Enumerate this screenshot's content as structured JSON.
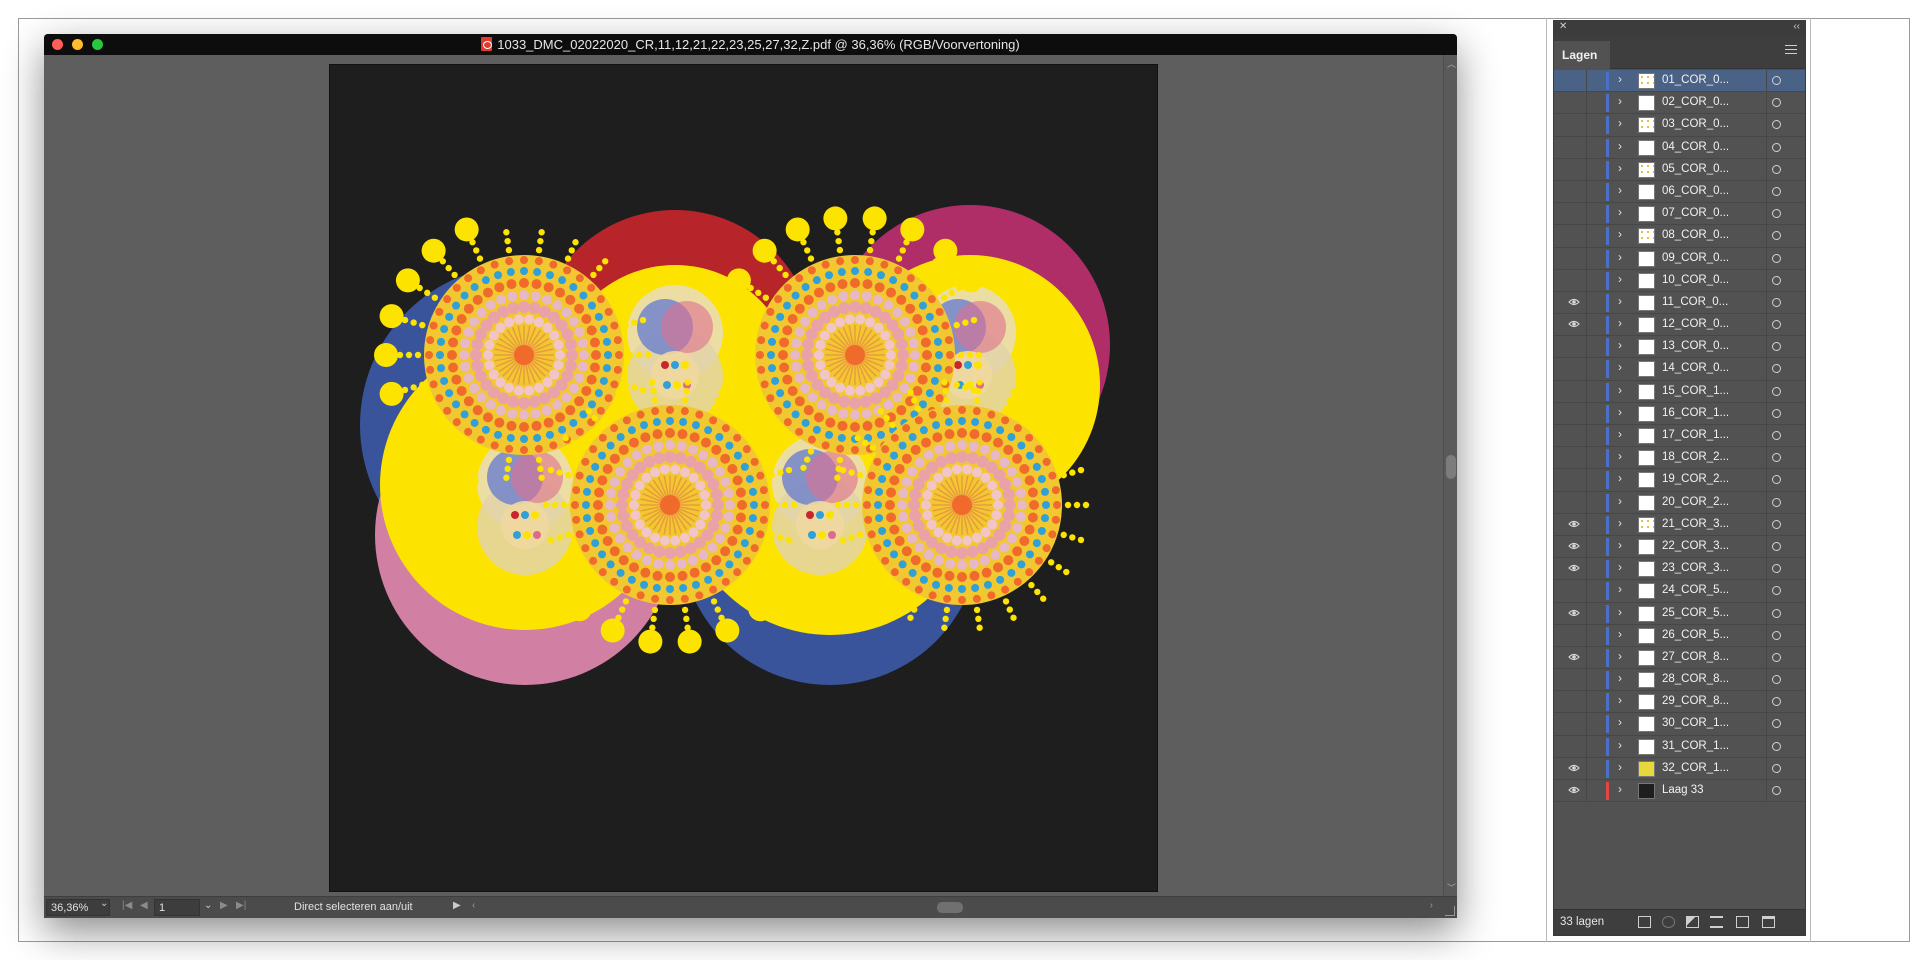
{
  "window": {
    "title": "1033_DMC_02022020_CR,11,12,21,22,23,25,27,32,Z.pdf @ 36,36% (RGB/Voorvertoning)",
    "zoom": "36,36%",
    "page": "1",
    "status_text": "Direct selecteren aan/uit"
  },
  "panel": {
    "tab_label": "Lagen",
    "layer_count": "33 lagen",
    "layers": [
      {
        "name": "01_COR_0...",
        "visible": false,
        "color": "#4c6fc8",
        "thumb": "dotted",
        "selected": true
      },
      {
        "name": "02_COR_0...",
        "visible": false,
        "color": "#4c6fc8",
        "thumb": "white"
      },
      {
        "name": "03_COR_0...",
        "visible": false,
        "color": "#4c6fc8",
        "thumb": "dotted"
      },
      {
        "name": "04_COR_0...",
        "visible": false,
        "color": "#4c6fc8",
        "thumb": "white"
      },
      {
        "name": "05_COR_0...",
        "visible": false,
        "color": "#4c6fc8",
        "thumb": "dotted"
      },
      {
        "name": "06_COR_0...",
        "visible": false,
        "color": "#4c6fc8",
        "thumb": "white"
      },
      {
        "name": "07_COR_0...",
        "visible": false,
        "color": "#4c6fc8",
        "thumb": "white"
      },
      {
        "name": "08_COR_0...",
        "visible": false,
        "color": "#4c6fc8",
        "thumb": "dotted"
      },
      {
        "name": "09_COR_0...",
        "visible": false,
        "color": "#4c6fc8",
        "thumb": "white"
      },
      {
        "name": "10_COR_0...",
        "visible": false,
        "color": "#4c6fc8",
        "thumb": "white"
      },
      {
        "name": "11_COR_0...",
        "visible": true,
        "color": "#4c6fc8",
        "thumb": "white"
      },
      {
        "name": "12_COR_0...",
        "visible": true,
        "color": "#4c6fc8",
        "thumb": "white"
      },
      {
        "name": "13_COR_0...",
        "visible": false,
        "color": "#4c6fc8",
        "thumb": "white"
      },
      {
        "name": "14_COR_0...",
        "visible": false,
        "color": "#4c6fc8",
        "thumb": "white"
      },
      {
        "name": "15_COR_1...",
        "visible": false,
        "color": "#4c6fc8",
        "thumb": "white"
      },
      {
        "name": "16_COR_1...",
        "visible": false,
        "color": "#4c6fc8",
        "thumb": "white"
      },
      {
        "name": "17_COR_1...",
        "visible": false,
        "color": "#4c6fc8",
        "thumb": "white"
      },
      {
        "name": "18_COR_2...",
        "visible": false,
        "color": "#4c6fc8",
        "thumb": "white"
      },
      {
        "name": "19_COR_2...",
        "visible": false,
        "color": "#4c6fc8",
        "thumb": "white"
      },
      {
        "name": "20_COR_2...",
        "visible": false,
        "color": "#4c6fc8",
        "thumb": "white"
      },
      {
        "name": "21_COR_3...",
        "visible": true,
        "color": "#4c6fc8",
        "thumb": "dotted"
      },
      {
        "name": "22_COR_3...",
        "visible": true,
        "color": "#4c6fc8",
        "thumb": "white"
      },
      {
        "name": "23_COR_3...",
        "visible": true,
        "color": "#4c6fc8",
        "thumb": "white"
      },
      {
        "name": "24_COR_5...",
        "visible": false,
        "color": "#4c6fc8",
        "thumb": "white"
      },
      {
        "name": "25_COR_5...",
        "visible": true,
        "color": "#4c6fc8",
        "thumb": "white"
      },
      {
        "name": "26_COR_5...",
        "visible": false,
        "color": "#4c6fc8",
        "thumb": "white"
      },
      {
        "name": "27_COR_8...",
        "visible": true,
        "color": "#4c6fc8",
        "thumb": "white"
      },
      {
        "name": "28_COR_8...",
        "visible": false,
        "color": "#4c6fc8",
        "thumb": "white"
      },
      {
        "name": "29_COR_8...",
        "visible": false,
        "color": "#4c6fc8",
        "thumb": "white"
      },
      {
        "name": "30_COR_1...",
        "visible": false,
        "color": "#4c6fc8",
        "thumb": "white"
      },
      {
        "name": "31_COR_1...",
        "visible": false,
        "color": "#4c6fc8",
        "thumb": "white"
      },
      {
        "name": "32_COR_1...",
        "visible": true,
        "color": "#4c6fc8",
        "thumb": "yellow"
      },
      {
        "name": "Laag 33",
        "visible": true,
        "color": "#e04848",
        "thumb": "dark"
      }
    ]
  },
  "colors": {
    "yellow": "#fde400",
    "orange": "#f06a2c",
    "blue": "#2fa0d8",
    "pink": "#e6b8c8",
    "red": "#c8262c",
    "artboard": "#1e1e1e"
  }
}
